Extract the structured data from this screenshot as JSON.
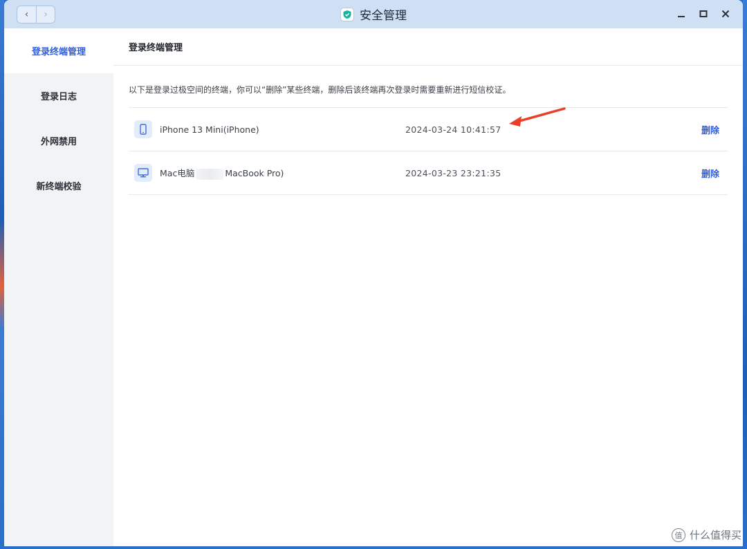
{
  "window": {
    "title": "安全管理",
    "nav_back": "‹",
    "nav_forward": "›"
  },
  "sidebar": {
    "items": [
      {
        "label": "登录终端管理",
        "active": true
      },
      {
        "label": "登录日志",
        "active": false
      },
      {
        "label": "外网禁用",
        "active": false
      },
      {
        "label": "新终端校验",
        "active": false
      }
    ]
  },
  "main": {
    "header": "登录终端管理",
    "description": "以下是登录过极空间的终端，你可以“删除”某些终端，删除后该终端再次登录时需要重新进行短信校证。",
    "devices": [
      {
        "icon": "phone-icon",
        "name": "iPhone 13 Mini(iPhone)",
        "time": "2024-03-24 10:41:57",
        "action": "删除"
      },
      {
        "icon": "desktop-icon",
        "name_prefix": "Mac电脑",
        "name_suffix": "MacBook Pro)",
        "time": "2024-03-23 23:21:35",
        "action": "删除"
      }
    ]
  },
  "watermark": {
    "symbol": "值",
    "text": "什么值得买"
  },
  "colors": {
    "accent": "#2f5fe0",
    "titlebar": "#cfe0f4",
    "sidebar_bg": "#f2f3f5",
    "arrow": "#e8402a"
  }
}
